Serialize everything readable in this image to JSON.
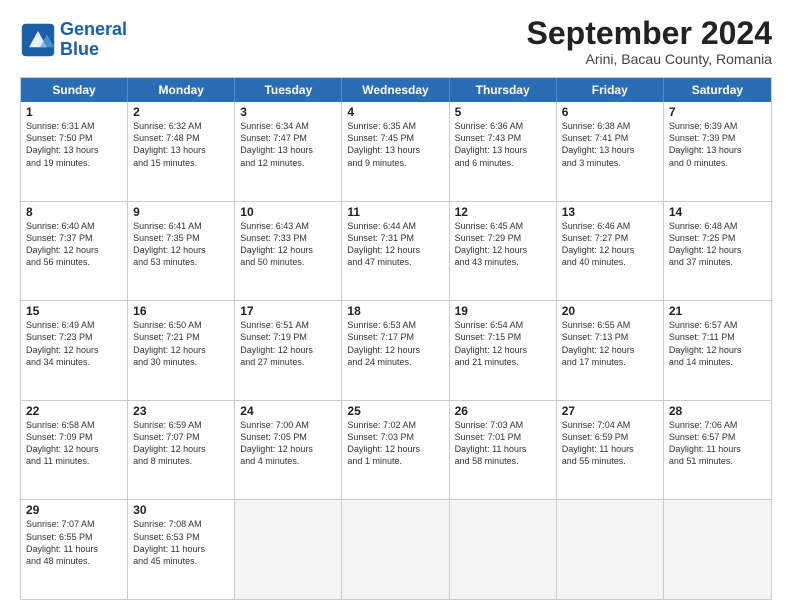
{
  "header": {
    "logo_line1": "General",
    "logo_line2": "Blue",
    "month": "September 2024",
    "location": "Arini, Bacau County, Romania"
  },
  "days_of_week": [
    "Sunday",
    "Monday",
    "Tuesday",
    "Wednesday",
    "Thursday",
    "Friday",
    "Saturday"
  ],
  "weeks": [
    [
      {
        "day": "1",
        "lines": [
          "Sunrise: 6:31 AM",
          "Sunset: 7:50 PM",
          "Daylight: 13 hours",
          "and 19 minutes."
        ]
      },
      {
        "day": "2",
        "lines": [
          "Sunrise: 6:32 AM",
          "Sunset: 7:48 PM",
          "Daylight: 13 hours",
          "and 15 minutes."
        ]
      },
      {
        "day": "3",
        "lines": [
          "Sunrise: 6:34 AM",
          "Sunset: 7:47 PM",
          "Daylight: 13 hours",
          "and 12 minutes."
        ]
      },
      {
        "day": "4",
        "lines": [
          "Sunrise: 6:35 AM",
          "Sunset: 7:45 PM",
          "Daylight: 13 hours",
          "and 9 minutes."
        ]
      },
      {
        "day": "5",
        "lines": [
          "Sunrise: 6:36 AM",
          "Sunset: 7:43 PM",
          "Daylight: 13 hours",
          "and 6 minutes."
        ]
      },
      {
        "day": "6",
        "lines": [
          "Sunrise: 6:38 AM",
          "Sunset: 7:41 PM",
          "Daylight: 13 hours",
          "and 3 minutes."
        ]
      },
      {
        "day": "7",
        "lines": [
          "Sunrise: 6:39 AM",
          "Sunset: 7:39 PM",
          "Daylight: 13 hours",
          "and 0 minutes."
        ]
      }
    ],
    [
      {
        "day": "8",
        "lines": [
          "Sunrise: 6:40 AM",
          "Sunset: 7:37 PM",
          "Daylight: 12 hours",
          "and 56 minutes."
        ]
      },
      {
        "day": "9",
        "lines": [
          "Sunrise: 6:41 AM",
          "Sunset: 7:35 PM",
          "Daylight: 12 hours",
          "and 53 minutes."
        ]
      },
      {
        "day": "10",
        "lines": [
          "Sunrise: 6:43 AM",
          "Sunset: 7:33 PM",
          "Daylight: 12 hours",
          "and 50 minutes."
        ]
      },
      {
        "day": "11",
        "lines": [
          "Sunrise: 6:44 AM",
          "Sunset: 7:31 PM",
          "Daylight: 12 hours",
          "and 47 minutes."
        ]
      },
      {
        "day": "12",
        "lines": [
          "Sunrise: 6:45 AM",
          "Sunset: 7:29 PM",
          "Daylight: 12 hours",
          "and 43 minutes."
        ]
      },
      {
        "day": "13",
        "lines": [
          "Sunrise: 6:46 AM",
          "Sunset: 7:27 PM",
          "Daylight: 12 hours",
          "and 40 minutes."
        ]
      },
      {
        "day": "14",
        "lines": [
          "Sunrise: 6:48 AM",
          "Sunset: 7:25 PM",
          "Daylight: 12 hours",
          "and 37 minutes."
        ]
      }
    ],
    [
      {
        "day": "15",
        "lines": [
          "Sunrise: 6:49 AM",
          "Sunset: 7:23 PM",
          "Daylight: 12 hours",
          "and 34 minutes."
        ]
      },
      {
        "day": "16",
        "lines": [
          "Sunrise: 6:50 AM",
          "Sunset: 7:21 PM",
          "Daylight: 12 hours",
          "and 30 minutes."
        ]
      },
      {
        "day": "17",
        "lines": [
          "Sunrise: 6:51 AM",
          "Sunset: 7:19 PM",
          "Daylight: 12 hours",
          "and 27 minutes."
        ]
      },
      {
        "day": "18",
        "lines": [
          "Sunrise: 6:53 AM",
          "Sunset: 7:17 PM",
          "Daylight: 12 hours",
          "and 24 minutes."
        ]
      },
      {
        "day": "19",
        "lines": [
          "Sunrise: 6:54 AM",
          "Sunset: 7:15 PM",
          "Daylight: 12 hours",
          "and 21 minutes."
        ]
      },
      {
        "day": "20",
        "lines": [
          "Sunrise: 6:55 AM",
          "Sunset: 7:13 PM",
          "Daylight: 12 hours",
          "and 17 minutes."
        ]
      },
      {
        "day": "21",
        "lines": [
          "Sunrise: 6:57 AM",
          "Sunset: 7:11 PM",
          "Daylight: 12 hours",
          "and 14 minutes."
        ]
      }
    ],
    [
      {
        "day": "22",
        "lines": [
          "Sunrise: 6:58 AM",
          "Sunset: 7:09 PM",
          "Daylight: 12 hours",
          "and 11 minutes."
        ]
      },
      {
        "day": "23",
        "lines": [
          "Sunrise: 6:59 AM",
          "Sunset: 7:07 PM",
          "Daylight: 12 hours",
          "and 8 minutes."
        ]
      },
      {
        "day": "24",
        "lines": [
          "Sunrise: 7:00 AM",
          "Sunset: 7:05 PM",
          "Daylight: 12 hours",
          "and 4 minutes."
        ]
      },
      {
        "day": "25",
        "lines": [
          "Sunrise: 7:02 AM",
          "Sunset: 7:03 PM",
          "Daylight: 12 hours",
          "and 1 minute."
        ]
      },
      {
        "day": "26",
        "lines": [
          "Sunrise: 7:03 AM",
          "Sunset: 7:01 PM",
          "Daylight: 11 hours",
          "and 58 minutes."
        ]
      },
      {
        "day": "27",
        "lines": [
          "Sunrise: 7:04 AM",
          "Sunset: 6:59 PM",
          "Daylight: 11 hours",
          "and 55 minutes."
        ]
      },
      {
        "day": "28",
        "lines": [
          "Sunrise: 7:06 AM",
          "Sunset: 6:57 PM",
          "Daylight: 11 hours",
          "and 51 minutes."
        ]
      }
    ],
    [
      {
        "day": "29",
        "lines": [
          "Sunrise: 7:07 AM",
          "Sunset: 6:55 PM",
          "Daylight: 11 hours",
          "and 48 minutes."
        ]
      },
      {
        "day": "30",
        "lines": [
          "Sunrise: 7:08 AM",
          "Sunset: 6:53 PM",
          "Daylight: 11 hours",
          "and 45 minutes."
        ]
      },
      {
        "day": "",
        "lines": []
      },
      {
        "day": "",
        "lines": []
      },
      {
        "day": "",
        "lines": []
      },
      {
        "day": "",
        "lines": []
      },
      {
        "day": "",
        "lines": []
      }
    ]
  ]
}
